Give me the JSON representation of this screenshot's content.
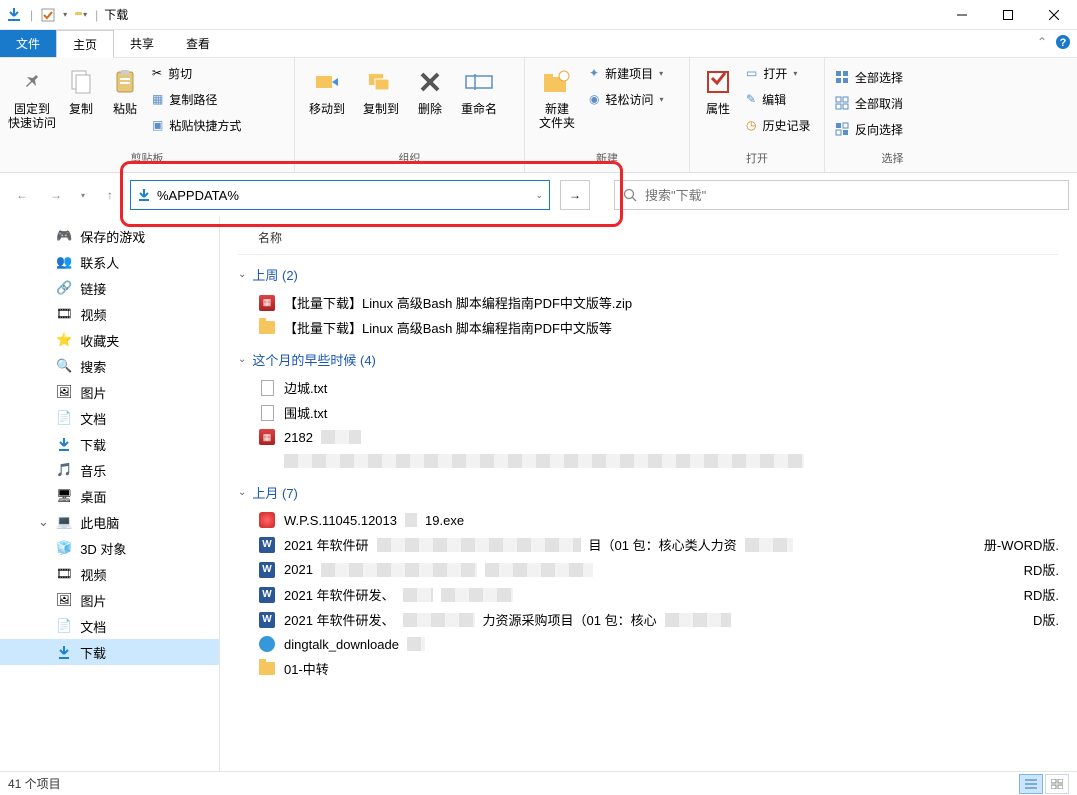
{
  "window": {
    "title": "下载",
    "min_tooltip": "最小化",
    "max_tooltip": "最大化",
    "close_tooltip": "关闭"
  },
  "tabs": {
    "file": "文件",
    "home": "主页",
    "share": "共享",
    "view": "查看"
  },
  "ribbon": {
    "clipboard": {
      "label": "剪贴板",
      "pin": "固定到\n快速访问",
      "copy": "复制",
      "paste": "粘贴",
      "cut": "剪切",
      "copy_path": "复制路径",
      "paste_shortcut": "粘贴快捷方式"
    },
    "organize": {
      "label": "组织",
      "move_to": "移动到",
      "copy_to": "复制到",
      "delete": "删除",
      "rename": "重命名"
    },
    "new": {
      "label": "新建",
      "new_folder": "新建\n文件夹",
      "new_item": "新建项目",
      "easy_access": "轻松访问"
    },
    "open": {
      "label": "打开",
      "properties": "属性",
      "open": "打开",
      "edit": "编辑",
      "history": "历史记录"
    },
    "select": {
      "label": "选择",
      "select_all": "全部选择",
      "select_none": "全部取消",
      "invert": "反向选择"
    }
  },
  "address": {
    "value": "%APPDATA%",
    "search_placeholder": "搜索\"下载\""
  },
  "navpane": [
    {
      "icon": "gamepad",
      "label": "保存的游戏"
    },
    {
      "icon": "contacts",
      "label": "联系人"
    },
    {
      "icon": "link",
      "label": "链接"
    },
    {
      "icon": "video",
      "label": "视频"
    },
    {
      "icon": "fav",
      "label": "收藏夹"
    },
    {
      "icon": "search",
      "label": "搜索"
    },
    {
      "icon": "picture",
      "label": "图片"
    },
    {
      "icon": "docs",
      "label": "文档"
    },
    {
      "icon": "download",
      "label": "下载"
    },
    {
      "icon": "music",
      "label": "音乐"
    },
    {
      "icon": "desktop",
      "label": "桌面"
    },
    {
      "icon": "pc",
      "label": "此电脑",
      "chev": true
    },
    {
      "icon": "3d",
      "label": "3D 对象"
    },
    {
      "icon": "video",
      "label": "视频"
    },
    {
      "icon": "picture",
      "label": "图片"
    },
    {
      "icon": "docs",
      "label": "文档"
    },
    {
      "icon": "download",
      "label": "下载",
      "sel": true
    }
  ],
  "columns": {
    "name": "名称"
  },
  "groups": [
    {
      "title": "上周 (2)",
      "items": [
        {
          "icon": "zip",
          "text": "【批量下载】Linux 高级Bash 脚本编程指南PDF中文版等.zip"
        },
        {
          "icon": "folder",
          "text": "【批量下载】Linux 高级Bash 脚本编程指南PDF中文版等"
        }
      ]
    },
    {
      "title": "这个月的早些时候 (4)",
      "items": [
        {
          "icon": "txt",
          "text": "边城.txt"
        },
        {
          "icon": "txt",
          "text": "围城.txt"
        },
        {
          "icon": "zip",
          "text": "2182.zip",
          "partial_censor": true
        },
        {
          "icon": "blank",
          "text": "",
          "full_censor": true
        }
      ]
    },
    {
      "title": "上月 (7)",
      "items": [
        {
          "icon": "exe",
          "text": "W.P.S.11045.12013",
          "censor_mid": "  ",
          "tail": "19.exe"
        },
        {
          "icon": "word",
          "text": "2021 年软件研",
          "censor_mid": "                                  ",
          "tail": "目（01 包：核心类人力资",
          "end_censor": "        ",
          "tail2": "册-WORD版."
        },
        {
          "icon": "word",
          "text": "2021",
          "censor_mid": "                       运维人",
          "tail": "",
          "end_censor": "        购项目（01 包：核",
          "tail2": "RD版."
        },
        {
          "icon": "word",
          "text": "2021 年软件研发、",
          "censor_mid": "    运",
          "tail": "",
          "end_censor": " 源采购项目（01 包：",
          "tail2": "RD版."
        },
        {
          "icon": "word",
          "text": "2021 年软件研发、",
          "censor_mid": "            ",
          "tail": "力资源采购项目（01 包：核心",
          "end_censor": "           ",
          "tail2": "D版."
        },
        {
          "icon": "exe2",
          "text": "dingtalk_downloade",
          "censor_mid": "   ",
          "tail": ""
        },
        {
          "icon": "folder",
          "text": "01-中转"
        }
      ]
    }
  ],
  "status": {
    "count": "41 个项目"
  }
}
